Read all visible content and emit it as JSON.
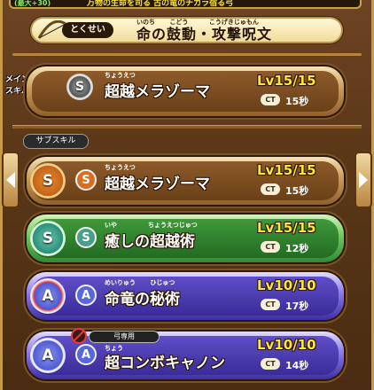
{
  "header": {
    "left_text": "(最大+30)",
    "desc_text": "万物の生命を司る 古の竜のチカラ宿る弓"
  },
  "tokusei": {
    "label": "とくせい",
    "ruby": "いのち　　 こどう　　　 こうげきじゅもん",
    "title": "命の鼓動・攻撃呪文"
  },
  "main_skill": {
    "label": "メイン\nスキル",
    "type": "S",
    "ruby": "ちょうえつ",
    "name": "超越メラゾーマ",
    "level": "Lv15/15",
    "ct_label": "CT",
    "ct_value": "15秒",
    "color": "#c89a58"
  },
  "sub_tab_label": "サブスキル",
  "sub_skills": [
    {
      "type": "S",
      "ruby": "ちょうえつ",
      "name": "超越メラゾーマ",
      "level": "Lv15/15",
      "ct_label": "CT",
      "ct_value": "15秒",
      "color": "gold"
    },
    {
      "type": "S",
      "ruby": "いや　　　　　ちょうえつじゅつ",
      "name": "癒しの超越術",
      "level": "Lv15/15",
      "ct_label": "CT",
      "ct_value": "12秒",
      "color": "green"
    },
    {
      "type": "A",
      "ruby": "めいりゅう　　 ひじゅつ",
      "name": "命竜の秘術",
      "level": "Lv10/10",
      "ct_label": "CT",
      "ct_value": "17秒",
      "color": "purple"
    },
    {
      "type": "A",
      "ruby": "ちょう",
      "name": "超コンボキャノン",
      "level": "Lv10/10",
      "ct_label": "CT",
      "ct_value": "14秒",
      "color": "purple",
      "tag": "弓専用"
    }
  ]
}
